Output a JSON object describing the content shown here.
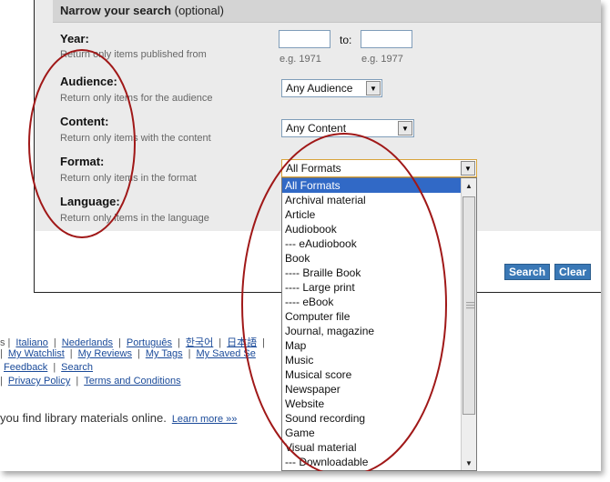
{
  "panel": {
    "title": "Narrow your search",
    "title_suffix": "(optional)"
  },
  "fields": {
    "year": {
      "label": "Year:",
      "help": "Return only items published from",
      "to_label": "to:",
      "from_hint": "e.g. 1971",
      "to_hint": "e.g. 1977",
      "from_value": "",
      "to_value": ""
    },
    "audience": {
      "label": "Audience:",
      "help": "Return only items for the audience",
      "selected": "Any Audience"
    },
    "content": {
      "label": "Content:",
      "help": "Return only items with the content",
      "selected": "Any Content"
    },
    "format": {
      "label": "Format:",
      "help": "Return only items in the format",
      "selected": "All Formats"
    },
    "language": {
      "label": "Language:",
      "help": "Return only items in the language"
    }
  },
  "format_options": [
    "All Formats",
    "Archival material",
    "Article",
    "Audiobook",
    "--- eAudiobook",
    "Book",
    "---- Braille Book",
    "---- Large print",
    "---- eBook",
    "Computer file",
    "Journal, magazine",
    "Map",
    "Music",
    "Musical score",
    "Newspaper",
    "Website",
    "Sound recording",
    "Game",
    "Visual material",
    "--- Downloadable"
  ],
  "buttons": {
    "search": "Search",
    "clear": "Clear"
  },
  "footer": {
    "languages": [
      "Italiano",
      "Nederlands",
      "Português",
      "한국어",
      "日本語"
    ],
    "links_row1": [
      "My Watchlist",
      "My Reviews",
      "My Tags",
      "My Saved Se"
    ],
    "links_row2": [
      "Feedback",
      "Search"
    ],
    "links_row3": [
      "Privacy Policy",
      "Terms and Conditions"
    ],
    "tagline": "you find library materials online.",
    "learn_more": "Learn more »»"
  },
  "annotation_color": "#a01818"
}
